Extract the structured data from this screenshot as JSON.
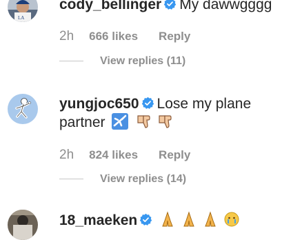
{
  "comments": [
    {
      "username": "cody_bellinger",
      "text": "My dawwgggg",
      "time": "2h",
      "likes": "666 likes",
      "reply": "Reply",
      "view_replies": "View replies (11)",
      "avatar_icon": "dodgers-player-avatar"
    },
    {
      "username": "yungjoc650",
      "text": "Lose my plane",
      "text_line2": "partner",
      "emojis": [
        "airplane-emoji",
        "thumbs-down-emoji",
        "thumbs-down-emoji"
      ],
      "time": "2h",
      "likes": "824 likes",
      "reply": "Reply",
      "view_replies": "View replies (14)",
      "avatar_icon": "pitcher-cartoon-avatar"
    },
    {
      "username": "18_maeken",
      "emojis": [
        "folded-hands-emoji",
        "folded-hands-emoji",
        "folded-hands-emoji",
        "crying-face-emoji"
      ],
      "avatar_icon": "player-photo-avatar"
    }
  ],
  "colors": {
    "verified": "#3897f0",
    "muted": "#8e8e8e",
    "text": "#262626"
  }
}
